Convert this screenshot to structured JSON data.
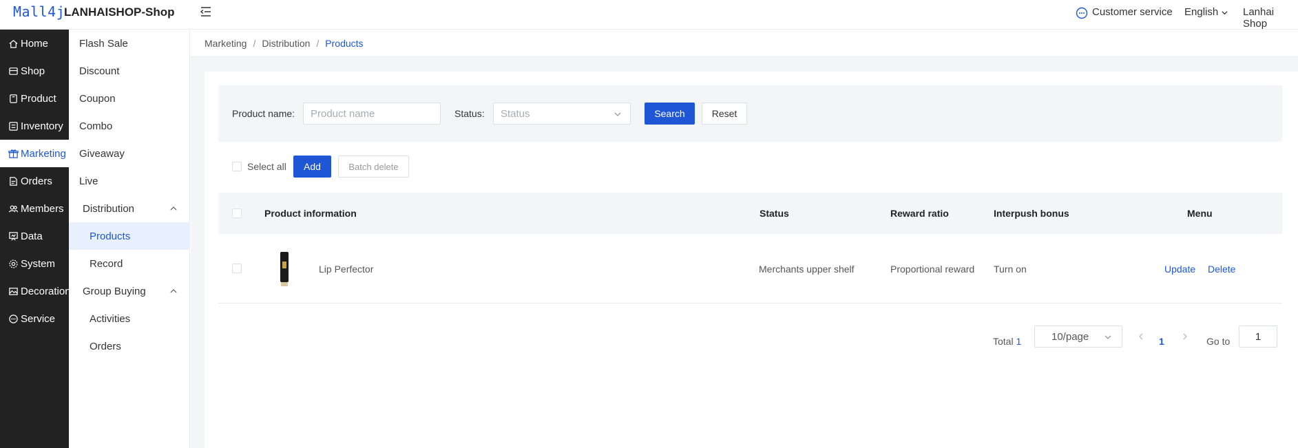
{
  "header": {
    "logo": "Mall4j",
    "shop_title": "LANHAISHOP-Shop",
    "customer_service": "Customer service",
    "language": "English",
    "user": "Lanhai Shop"
  },
  "sidebar_primary": {
    "items": [
      {
        "label": "Home",
        "icon": "home-icon"
      },
      {
        "label": "Shop",
        "icon": "shop-icon"
      },
      {
        "label": "Product",
        "icon": "product-icon"
      },
      {
        "label": "Inventory",
        "icon": "inventory-icon"
      },
      {
        "label": "Marketing",
        "icon": "gift-icon",
        "active": true
      },
      {
        "label": "Orders",
        "icon": "orders-icon"
      },
      {
        "label": "Members",
        "icon": "members-icon"
      },
      {
        "label": "Data",
        "icon": "data-icon"
      },
      {
        "label": "System",
        "icon": "gear-icon"
      },
      {
        "label": "Decoration",
        "icon": "decoration-icon"
      },
      {
        "label": "Service",
        "icon": "service-icon"
      }
    ]
  },
  "sidebar_secondary": {
    "items": [
      {
        "label": "Flash Sale"
      },
      {
        "label": "Discount"
      },
      {
        "label": "Coupon"
      },
      {
        "label": "Combo"
      },
      {
        "label": "Giveaway"
      },
      {
        "label": "Live"
      },
      {
        "label": "Distribution",
        "group": true
      },
      {
        "label": "Products",
        "active": true
      },
      {
        "label": "Record"
      },
      {
        "label": "Group Buying",
        "group": true
      },
      {
        "label": "Activities"
      },
      {
        "label": "Orders"
      }
    ]
  },
  "breadcrumb": {
    "items": [
      "Marketing",
      "Distribution"
    ],
    "separator": "/",
    "current": "Products"
  },
  "search": {
    "product_name_label": "Product name:",
    "product_name_placeholder": "Product name",
    "status_label": "Status:",
    "status_placeholder": "Status",
    "search_button": "Search",
    "reset_button": "Reset"
  },
  "toolbar": {
    "select_all": "Select all",
    "add_button": "Add",
    "batch_delete_button": "Batch delete"
  },
  "table": {
    "columns": [
      "Product information",
      "Status",
      "Reward ratio",
      "Interpush bonus",
      "Menu"
    ],
    "rows": [
      {
        "product": "Lip Perfector",
        "status": "Merchants upper shelf",
        "reward_ratio": "Proportional reward",
        "interpush_bonus": "Turn on",
        "actions": [
          "Update",
          "Delete"
        ]
      }
    ]
  },
  "pagination": {
    "total_label": "Total",
    "total": "1",
    "page_size": "10/page",
    "current_page": "1",
    "goto_label": "Go to",
    "goto_value": "1"
  },
  "colors": {
    "accent": "#1e56d6",
    "sidebar_bg": "#222222",
    "content_bg": "#f4f5f7"
  }
}
